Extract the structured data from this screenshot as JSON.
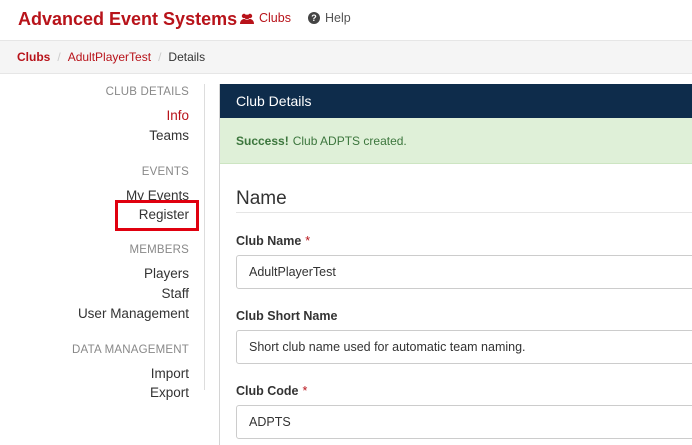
{
  "brand": "Advanced Event Systems",
  "nav": {
    "clubs_label": "Clubs",
    "help_label": "Help",
    "clubs_icon": "users-icon",
    "help_icon": "question-circle-icon"
  },
  "breadcrumb": {
    "root": "Clubs",
    "club": "AdultPlayerTest",
    "current": "Details"
  },
  "sidebar": {
    "club_details_heading": "CLUB DETAILS",
    "info": "Info",
    "teams": "Teams",
    "events_heading": "EVENTS",
    "my_events": "My Events",
    "register": "Register",
    "members_heading": "MEMBERS",
    "players": "Players",
    "staff": "Staff",
    "user_management": "User Management",
    "data_management_heading": "DATA MANAGEMENT",
    "import": "Import",
    "export": "Export"
  },
  "panel": {
    "title": "Club Details",
    "alert_strong": "Success!",
    "alert_text": "Club ADPTS created.",
    "section_title": "Name",
    "club_name_label": "Club Name",
    "club_name_value": "AdultPlayerTest",
    "short_name_label": "Club Short Name",
    "short_name_placeholder": "Short club name used for automatic team naming.",
    "club_code_label": "Club Code",
    "club_code_value": "ADPTS",
    "required_marker": "*"
  },
  "colors": {
    "brand_red": "#b8131a",
    "panel_header": "#0e2c4b",
    "success_bg": "#dff0d8",
    "highlight_box": "#e0000f"
  }
}
